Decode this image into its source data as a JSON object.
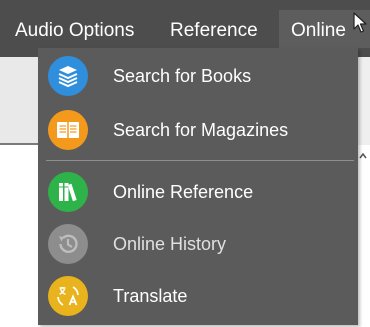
{
  "menubar": {
    "items": [
      {
        "label": "Audio Options"
      },
      {
        "label": "Reference"
      },
      {
        "label": "Online"
      }
    ]
  },
  "dropdown": {
    "items": [
      {
        "label": "Search for Books",
        "icon": "books-icon",
        "color": "#2f8fdc"
      },
      {
        "label": "Search for Magazines",
        "icon": "magazine-icon",
        "color": "#f39a1c"
      },
      {
        "label": "Online Reference",
        "icon": "reference-icon",
        "color": "#2db34a"
      },
      {
        "label": "Online History",
        "icon": "history-icon",
        "color": "#8d8d8d",
        "disabled": true
      },
      {
        "label": "Translate",
        "icon": "translate-icon",
        "color": "#e8b31c"
      }
    ]
  },
  "colors": {
    "menubar_bg": "#4d4d4d",
    "menubar_active_bg": "#5d5d5d",
    "dropdown_bg": "#5b5b5b"
  }
}
